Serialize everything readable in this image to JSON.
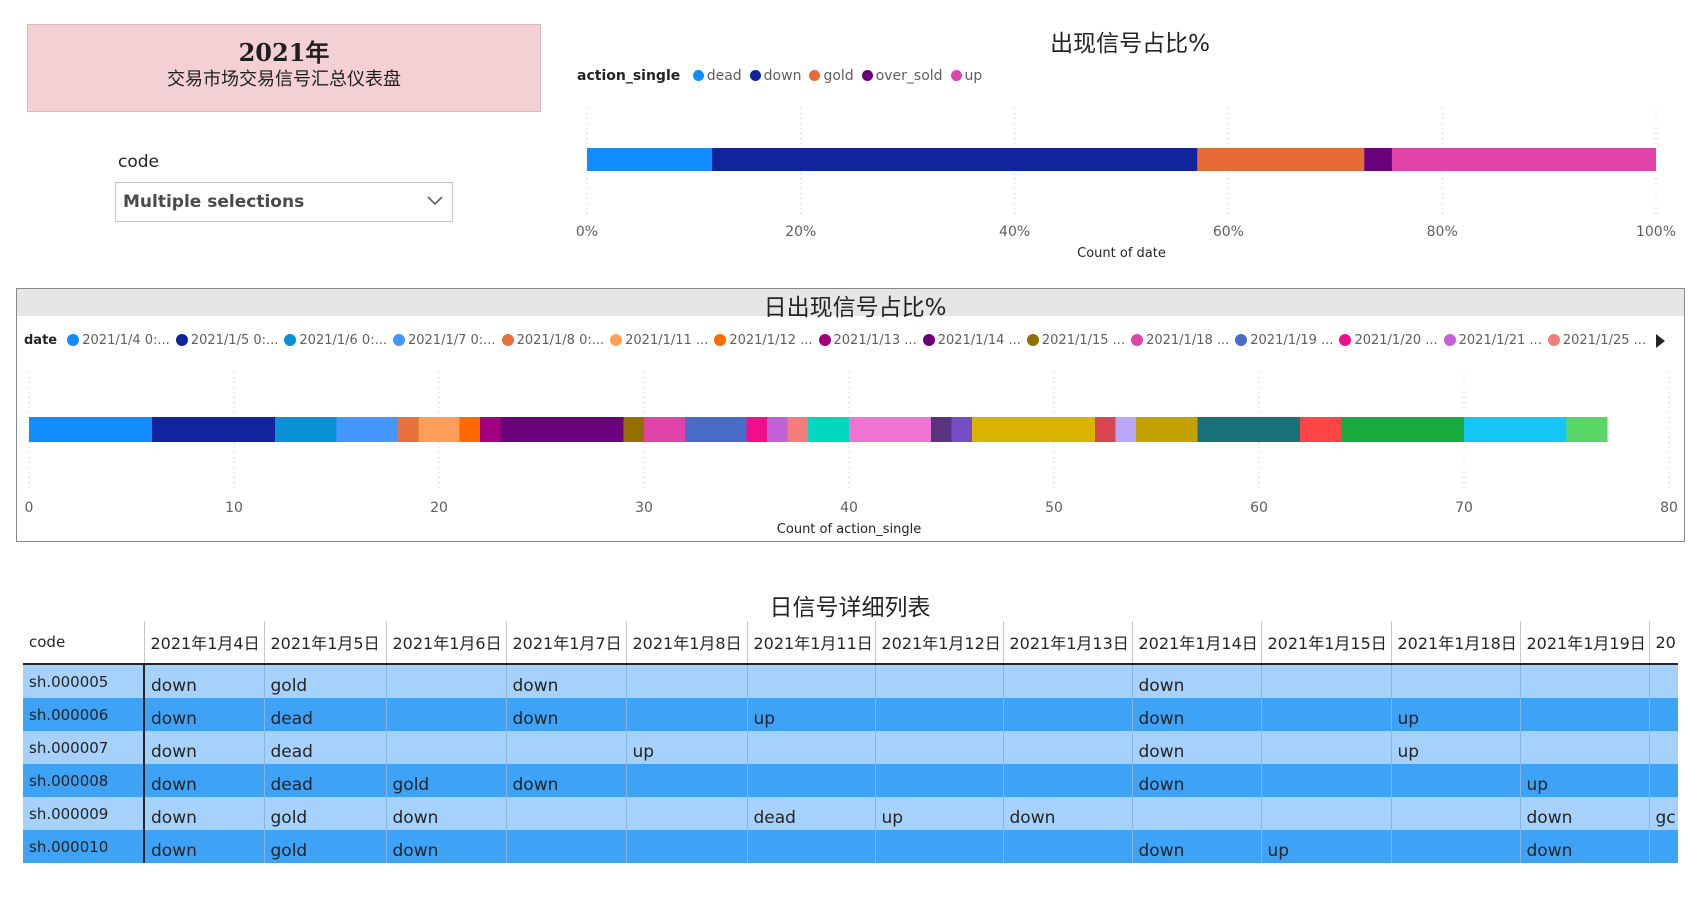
{
  "header": {
    "year": "2021年",
    "subtitle": "交易市场交易信号汇总仪表盘"
  },
  "slicer": {
    "label": "code",
    "value": "Multiple selections",
    "icon": "chevron-down-icon"
  },
  "chart1": {
    "title": "出现信号占比%",
    "legend_title": "action_single",
    "chart_data": {
      "type": "bar",
      "orientation": "horizontal-100%-stacked",
      "categories": [
        ""
      ],
      "series": [
        {
          "name": "dead",
          "color": "#118DFF",
          "values": [
            11.7
          ]
        },
        {
          "name": "down",
          "color": "#12239E",
          "values": [
            45.4
          ]
        },
        {
          "name": "gold",
          "color": "#E66C37",
          "values": [
            15.6
          ]
        },
        {
          "name": "over_sold",
          "color": "#6B007B",
          "values": [
            2.6
          ]
        },
        {
          "name": "up",
          "color": "#E044A7",
          "values": [
            24.7
          ]
        }
      ],
      "xticks": [
        "0%",
        "20%",
        "40%",
        "60%",
        "80%",
        "100%"
      ],
      "xlim": [
        0,
        100
      ],
      "xlabel": "Count of date",
      "legend": "top-left"
    }
  },
  "chart2": {
    "title": "日出现信号占比%",
    "legend_title": "date",
    "chart_data": {
      "type": "bar",
      "orientation": "horizontal-stacked",
      "categories": [
        ""
      ],
      "series": [
        {
          "name": "2021/1/4 0:...",
          "color": "#118DFF",
          "values": [
            6
          ]
        },
        {
          "name": "2021/1/5 0:...",
          "color": "#12239E",
          "values": [
            6
          ]
        },
        {
          "name": "2021/1/6 0:...",
          "color": "#0A91D5",
          "values": [
            3
          ]
        },
        {
          "name": "2021/1/7 0:...",
          "color": "#4596FF",
          "values": [
            3
          ]
        },
        {
          "name": "2021/1/8 0:...",
          "color": "#E8703C",
          "values": [
            1
          ]
        },
        {
          "name": "2021/1/11 ...",
          "color": "#FF9E59",
          "values": [
            2
          ]
        },
        {
          "name": "2021/1/12 ...",
          "color": "#FF6A00",
          "values": [
            1
          ]
        },
        {
          "name": "2021/1/13 ...",
          "color": "#A3007F",
          "values": [
            1
          ]
        },
        {
          "name": "2021/1/14 ...",
          "color": "#6B007B",
          "values": [
            6
          ]
        },
        {
          "name": "2021/1/15 ...",
          "color": "#946F00",
          "values": [
            1
          ]
        },
        {
          "name": "2021/1/18 ...",
          "color": "#E044A7",
          "values": [
            2
          ]
        },
        {
          "name": "2021/1/19 ...",
          "color": "#4A6CC9",
          "values": [
            3
          ]
        },
        {
          "name": "2021/1/20 ...",
          "color": "#F00E8A",
          "values": [
            1
          ]
        },
        {
          "name": "2021/1/21 ...",
          "color": "#C261D7",
          "values": [
            1
          ]
        },
        {
          "name": "2021/1/25 ...",
          "color": "#F47D7C",
          "values": [
            1
          ]
        },
        {
          "name": "",
          "color": "#00D8C0",
          "values": [
            2
          ]
        },
        {
          "name": "",
          "color": "#F174D5",
          "values": [
            4
          ]
        },
        {
          "name": "",
          "color": "#58347F",
          "values": [
            1
          ]
        },
        {
          "name": "",
          "color": "#744EC2",
          "values": [
            1
          ]
        },
        {
          "name": "",
          "color": "#D9B300",
          "values": [
            6
          ]
        },
        {
          "name": "",
          "color": "#D64550",
          "values": [
            1
          ]
        },
        {
          "name": "",
          "color": "#B9A6F5",
          "values": [
            1
          ]
        },
        {
          "name": "",
          "color": "#C4A102",
          "values": [
            3
          ]
        },
        {
          "name": "",
          "color": "#197278",
          "values": [
            5
          ]
        },
        {
          "name": "",
          "color": "#FF4545",
          "values": [
            2
          ]
        },
        {
          "name": "",
          "color": "#1AAB40",
          "values": [
            6
          ]
        },
        {
          "name": "",
          "color": "#15C6F4",
          "values": [
            5
          ]
        },
        {
          "name": "",
          "color": "#5AD666",
          "values": [
            2
          ]
        }
      ],
      "xticks": [
        "0",
        "10",
        "20",
        "30",
        "40",
        "50",
        "60",
        "70",
        "80"
      ],
      "xlim": [
        0,
        80
      ],
      "xlabel": "Count of action_single",
      "legend": "top-left"
    }
  },
  "table": {
    "title": "日信号详细列表",
    "columns": [
      "code",
      "2021年1月4日",
      "2021年1月5日",
      "2021年1月6日",
      "2021年1月7日",
      "2021年1月8日",
      "2021年1月11日",
      "2021年1月12日",
      "2021年1月13日",
      "2021年1月14日",
      "2021年1月15日",
      "2021年1月18日",
      "2021年1月19日",
      "20"
    ],
    "rows": [
      [
        "sh.000005",
        "down",
        "gold",
        "",
        "down",
        "",
        "",
        "",
        "",
        "down",
        "",
        "",
        "",
        ""
      ],
      [
        "sh.000006",
        "down",
        "dead",
        "",
        "down",
        "",
        "up",
        "",
        "",
        "down",
        "",
        "up",
        "",
        ""
      ],
      [
        "sh.000007",
        "down",
        "dead",
        "",
        "",
        "up",
        "",
        "",
        "",
        "down",
        "",
        "up",
        "",
        ""
      ],
      [
        "sh.000008",
        "down",
        "dead",
        "gold",
        "down",
        "",
        "",
        "",
        "",
        "down",
        "",
        "",
        "up",
        ""
      ],
      [
        "sh.000009",
        "down",
        "gold",
        "down",
        "",
        "",
        "dead",
        "up",
        "down",
        "",
        "",
        "",
        "down",
        "gc"
      ],
      [
        "sh.000010",
        "down",
        "gold",
        "down",
        "",
        "",
        "",
        "",
        "",
        "down",
        "up",
        "",
        "down",
        ""
      ]
    ]
  }
}
